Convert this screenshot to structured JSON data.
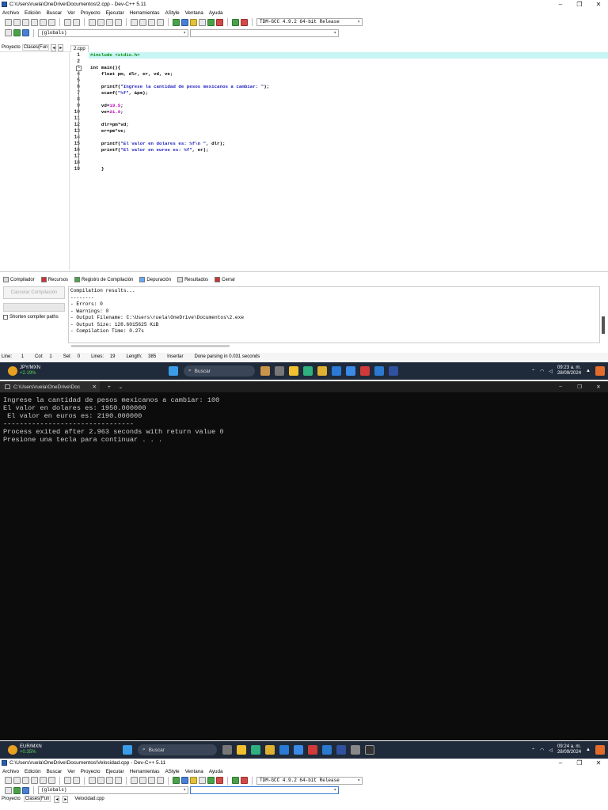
{
  "ide": {
    "title": "C:\\Users\\ruela\\OneDrive\\Documentos\\2.cpp - Dev-C++ 5.11",
    "menu": [
      "Archivo",
      "Edición",
      "Buscar",
      "Ver",
      "Proyecto",
      "Ejecutar",
      "Herramientas",
      "AStyle",
      "Ventana",
      "Ayuda"
    ],
    "compiler_select": "TDM-GCC 4.9.2 64-bit Release",
    "scope_select": "(globals)",
    "left_tabs": [
      "Proyecto",
      "Clases",
      "Fun"
    ],
    "file_tab": "2.cpp",
    "line_numbers": [
      "1",
      "2",
      "3",
      "4",
      "5",
      "6",
      "7",
      "8",
      "9",
      "10",
      "11",
      "12",
      "13",
      "14",
      "15",
      "16",
      "17",
      "18",
      "19"
    ],
    "code_lines": [
      "#include <stdio.h>",
      "",
      "int main(){",
      "    float pm, dlr, er, vd, ve;",
      "",
      "    printf(\"Ingrese la cantidad de pesos mexicanos a cambiar: \");",
      "    scanf(\"%f\", &pm);",
      "",
      "    vd=19.5;",
      "    ve=21.9;",
      "",
      "    dlr=pm*vd;",
      "    er=pm*ve;",
      "",
      "    printf(\"El valor en dolares es: %f\\n \", dlr);",
      "    printf(\"El valor en euros es: %f\", er);",
      "",
      "",
      "    }"
    ],
    "bottom_tabs": [
      "Compilador",
      "Recursos",
      "Registro de Compilación",
      "Depuración",
      "Resultados",
      "Cerrar"
    ],
    "cancel_button": "Cancelar Compilación",
    "shorten_paths": "Shorten compiler paths",
    "compile_log": [
      "Compilation results...",
      "--------",
      "- Errors: 0",
      "- Warnings: 0",
      "- Output Filename: C:\\Users\\ruela\\OneDrive\\Documentos\\2.exe",
      "- Output Size: 128.6015625 KiB",
      "- Compilation Time: 0.27s"
    ],
    "status": {
      "line": "Line:",
      "line_val": "1",
      "col": "Col:",
      "col_val": "1",
      "sel": "Sel:",
      "sel_val": "0",
      "lines": "Lines:",
      "lines_val": "19",
      "length": "Length:",
      "length_val": "385",
      "mode": "Insertar",
      "msg": "Done parsing in 0.031 seconds"
    }
  },
  "taskbar1": {
    "ticker": "JPY/MXN",
    "change": "+2.19%",
    "search": "Buscar",
    "time": "09:23 a. m.",
    "date": "28/09/2024"
  },
  "terminal": {
    "tab_title": "C:\\Users\\ruela\\OneDrive\\Doc",
    "new_tab": "+",
    "output": [
      "Ingrese la cantidad de pesos mexicanos a cambiar: 100",
      "El valor en dolares es: 1950.000000",
      " El valor en euros es: 2190.000000",
      "--------------------------------",
      "Process exited after 2.963 seconds with return value 0",
      "Presione una tecla para continuar . . ."
    ]
  },
  "taskbar2": {
    "ticker": "EUR/MXN",
    "change": "+0.35%",
    "search": "Buscar",
    "time": "09:24 a. m.",
    "date": "28/09/2024"
  },
  "ide2": {
    "title": "C:\\Users\\ruela\\OneDrive\\Documentos\\Velocidad.cpp - Dev-C++ 5.11",
    "menu": [
      "Archivo",
      "Edición",
      "Buscar",
      "Ver",
      "Proyecto",
      "Ejecutar",
      "Herramientas",
      "AStyle",
      "Ventana",
      "Ayuda"
    ],
    "compiler_select": "TDM-GCC 4.9.2 64-bit Release",
    "scope_select": "(globals)",
    "left_tabs": [
      "Proyecto",
      "Clases",
      "Fun"
    ],
    "file_tab": "Velocidad.cpp"
  }
}
